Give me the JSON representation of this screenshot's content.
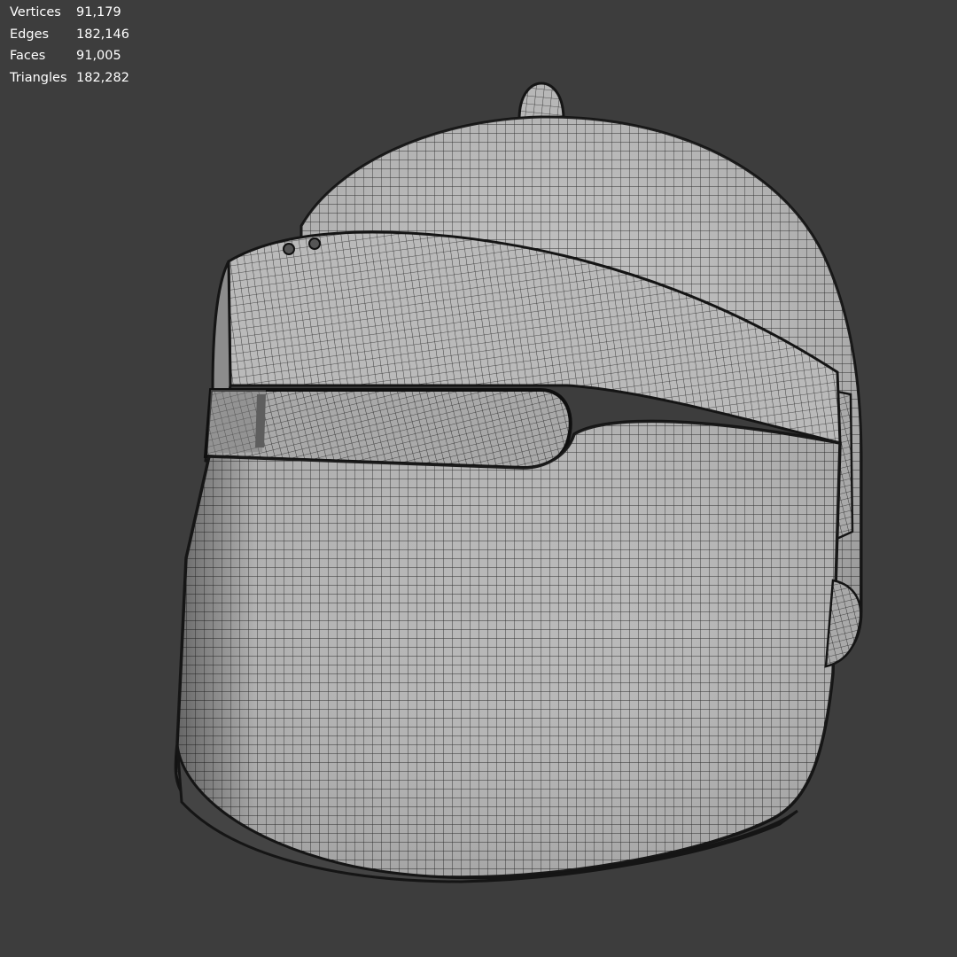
{
  "statistics": [
    {
      "label": "Vertices",
      "value": "91,179"
    },
    {
      "label": "Edges",
      "value": "182,146"
    },
    {
      "label": "Faces",
      "value": "91,005"
    },
    {
      "label": "Triangles",
      "value": "182,282"
    }
  ],
  "viewport": {
    "background_color": "#3d3d3d",
    "mesh_color": "#bdbdbd",
    "wire_color": "#1a1a1a",
    "object": "helmet"
  }
}
